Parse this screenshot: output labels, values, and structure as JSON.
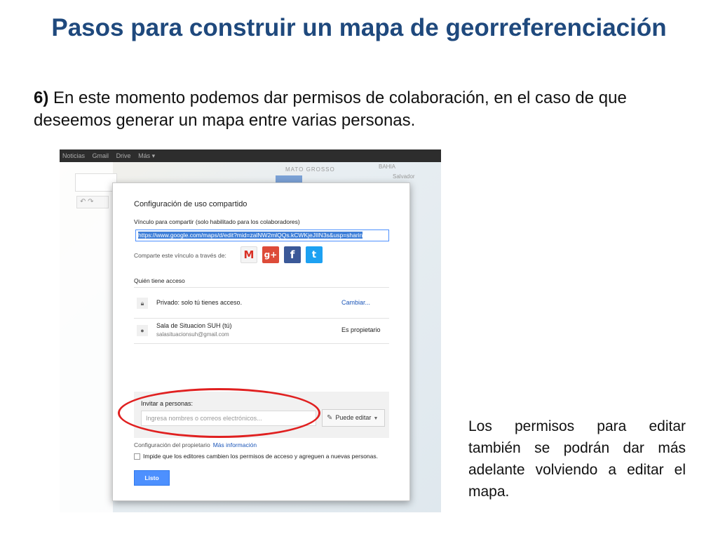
{
  "slide": {
    "title": "Pasos para construir un mapa de georreferenciación",
    "step_number": "6)",
    "step_text": " En este momento podemos dar permisos de colaboración, en el caso de que deseemos generar un mapa entre varias personas.",
    "side_note": "Los permisos para editar también se podrán dar más adelante volviendo a editar el mapa."
  },
  "topbar": {
    "items": [
      "Noticias",
      "Gmail",
      "Drive",
      "Más ▾"
    ]
  },
  "map": {
    "label_1": "MATO GROSSO",
    "label_2": "BAHIA",
    "label_3": "Salvador"
  },
  "dialog": {
    "title": "Configuración de uso compartido",
    "link_label": "Vínculo para compartir (solo habilitado para los colaboradores)",
    "link_value": "https://www.google.com/maps/d/edit?mid=zalNW2mlQQs.kCWKjeJIIN3s&usp=sharin",
    "share_label": "Comparte este vínculo a través de:",
    "share_icons": [
      "gmail-icon",
      "google-plus-icon",
      "facebook-icon",
      "twitter-icon"
    ],
    "access_label": "Quién tiene acceso",
    "access_rows": [
      {
        "text": "Privado: solo tú tienes acceso.",
        "action": "Cambiar..."
      },
      {
        "text": "Sala de Situacion SUH (tú)",
        "sub": "salasituacionsuh@gmail.com",
        "role": "Es propietario"
      }
    ],
    "invite_label": "Invitar a personas:",
    "invite_placeholder": "Ingresa nombres o correos electrónicos...",
    "permission_button": "Puede editar",
    "owner_settings": "Configuración del propietario",
    "more_info": "Más información",
    "owner_checkbox_label": "Impide que los editores cambien los permisos de acceso y agreguen a nuevas personas.",
    "done_button": "Listo"
  },
  "colors": {
    "title": "#1f497d",
    "highlight_oval": "#e02020",
    "primary_button": "#4d90fe"
  }
}
